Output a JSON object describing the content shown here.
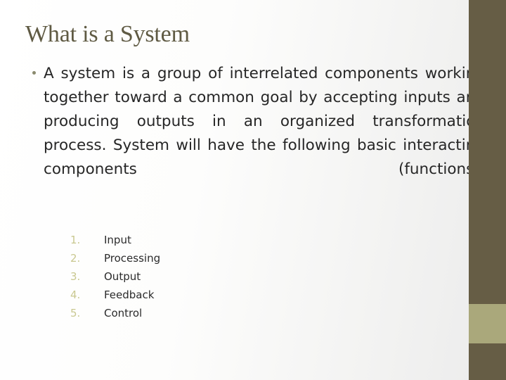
{
  "slide": {
    "title": "What is a System",
    "bullet": {
      "marker": "bullet-dot",
      "text": "A system is a group of interrelated components working together toward a common goal by accepting inputs and producing outputs in an organized transformation process. System will have the following basic interacting components (functions):"
    },
    "numbered_list": [
      {
        "number": "1.",
        "label": "Input"
      },
      {
        "number": "2.",
        "label": "Processing"
      },
      {
        "number": "3.",
        "label": "Output"
      },
      {
        "number": "4.",
        "label": "Feedback"
      },
      {
        "number": "5.",
        "label": "Control"
      }
    ],
    "decoration": {
      "bar_color": "#665d45",
      "accent_color": "#aaa87b",
      "title_color": "#5f5a43",
      "number_color": "#c9c890",
      "body_color": "#262626",
      "background_color": "#ffffff"
    }
  }
}
